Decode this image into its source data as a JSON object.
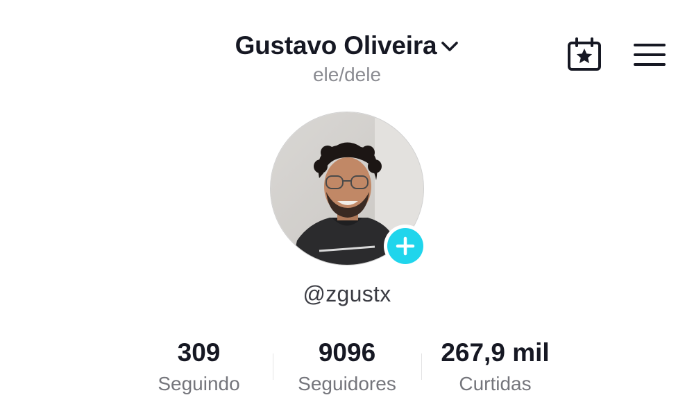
{
  "header": {
    "display_name": "Gustavo Oliveira",
    "pronouns": "ele/dele",
    "switch_account_icon": "chevron-down-icon",
    "calendar_icon": "calendar-star-icon",
    "menu_icon": "hamburger-menu-icon"
  },
  "profile": {
    "avatar_alt": "profile photo",
    "add_icon": "plus-icon",
    "username": "@zgustx"
  },
  "stats": [
    {
      "value": "309",
      "label": "Seguindo"
    },
    {
      "value": "9096",
      "label": "Seguidores"
    },
    {
      "value": "267,9 mil",
      "label": "Curtidas"
    }
  ],
  "colors": {
    "accent": "#20d5ec",
    "text_primary": "#161823",
    "text_secondary": "#8a8b91"
  }
}
